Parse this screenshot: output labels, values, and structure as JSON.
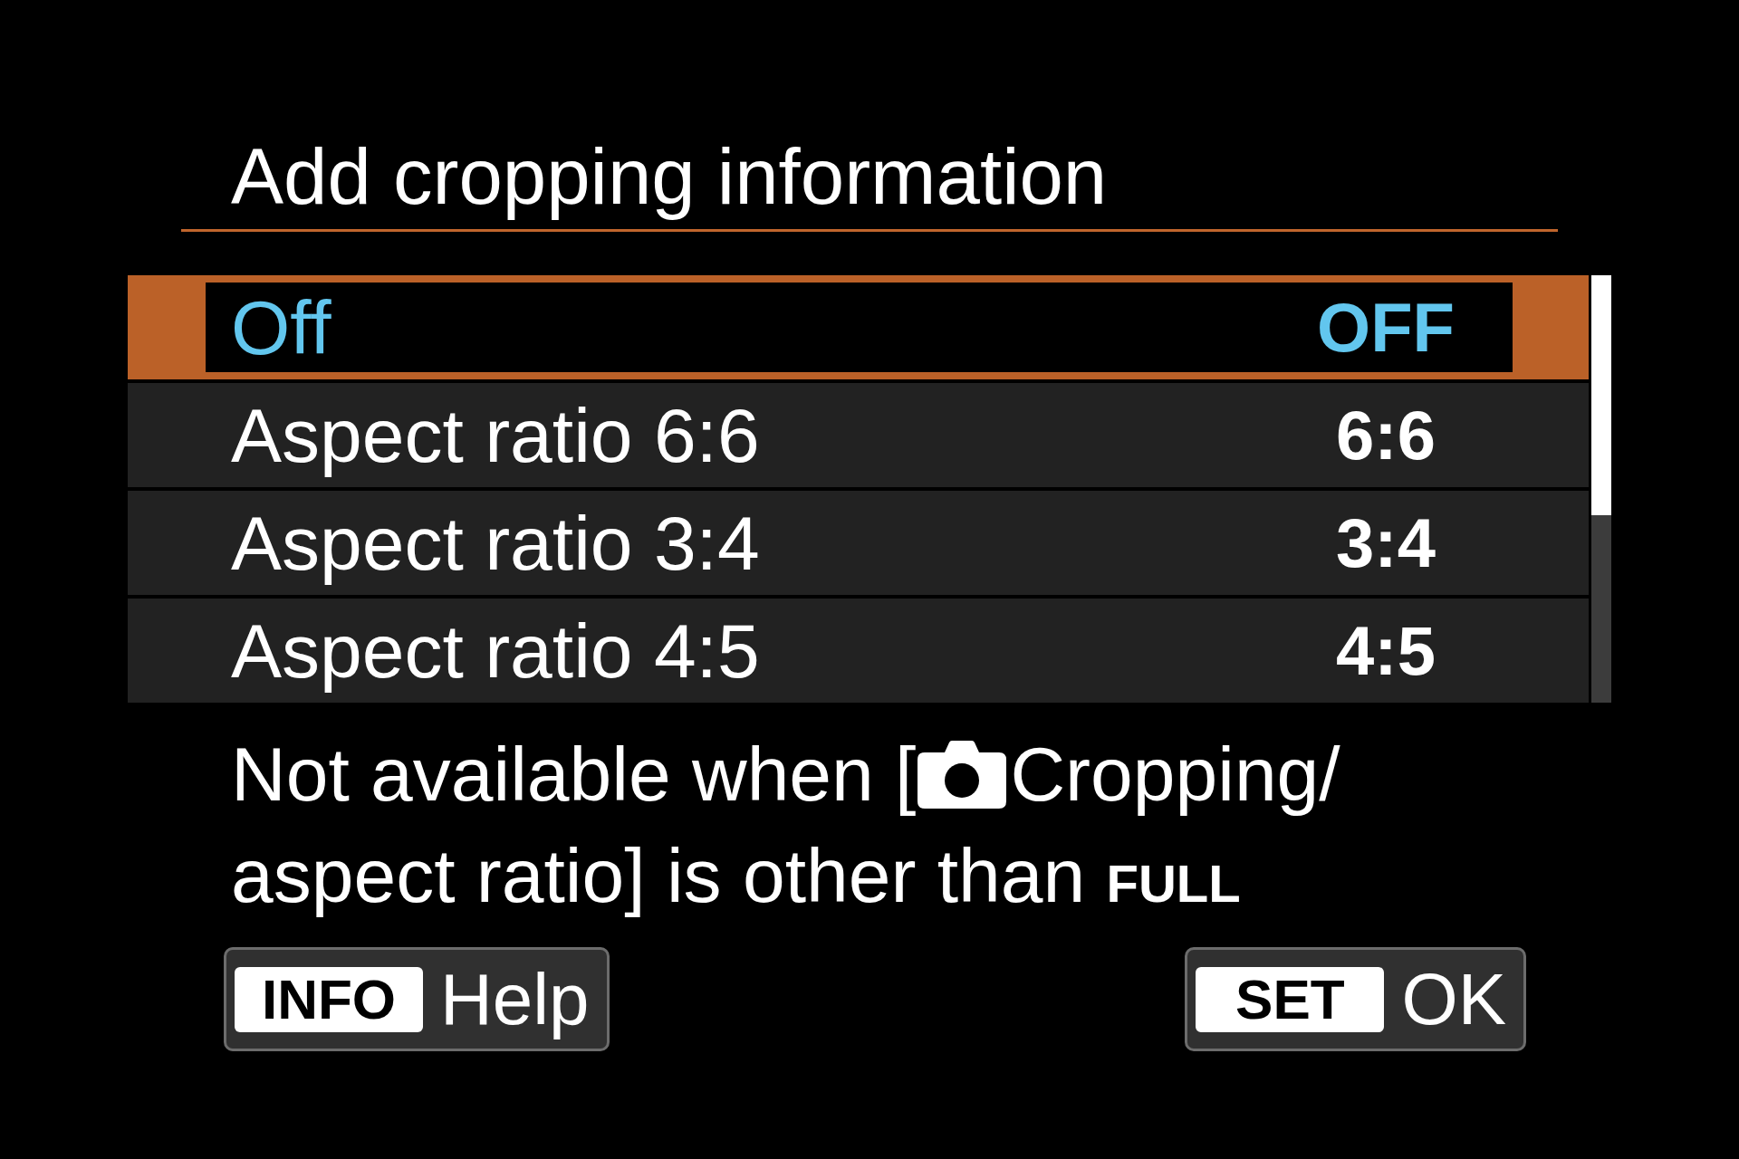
{
  "screen": {
    "title": "Add cropping information"
  },
  "menu": {
    "items": [
      {
        "label": "Off",
        "value": "OFF",
        "selected": true
      },
      {
        "label": "Aspect ratio 6:6",
        "value": "6:6",
        "selected": false
      },
      {
        "label": "Aspect ratio 3:4",
        "value": "3:4",
        "selected": false
      },
      {
        "label": "Aspect ratio 4:5",
        "value": "4:5",
        "selected": false
      }
    ]
  },
  "note": {
    "text_before_icon": "Not available when [",
    "text_after_icon": "Cropping/",
    "second_line": "aspect ratio] is other than **FULL**"
  },
  "buttons": [
    {
      "key": "INFO",
      "label": "Help"
    },
    {
      "key": "SET",
      "label": "OK"
    }
  ]
}
